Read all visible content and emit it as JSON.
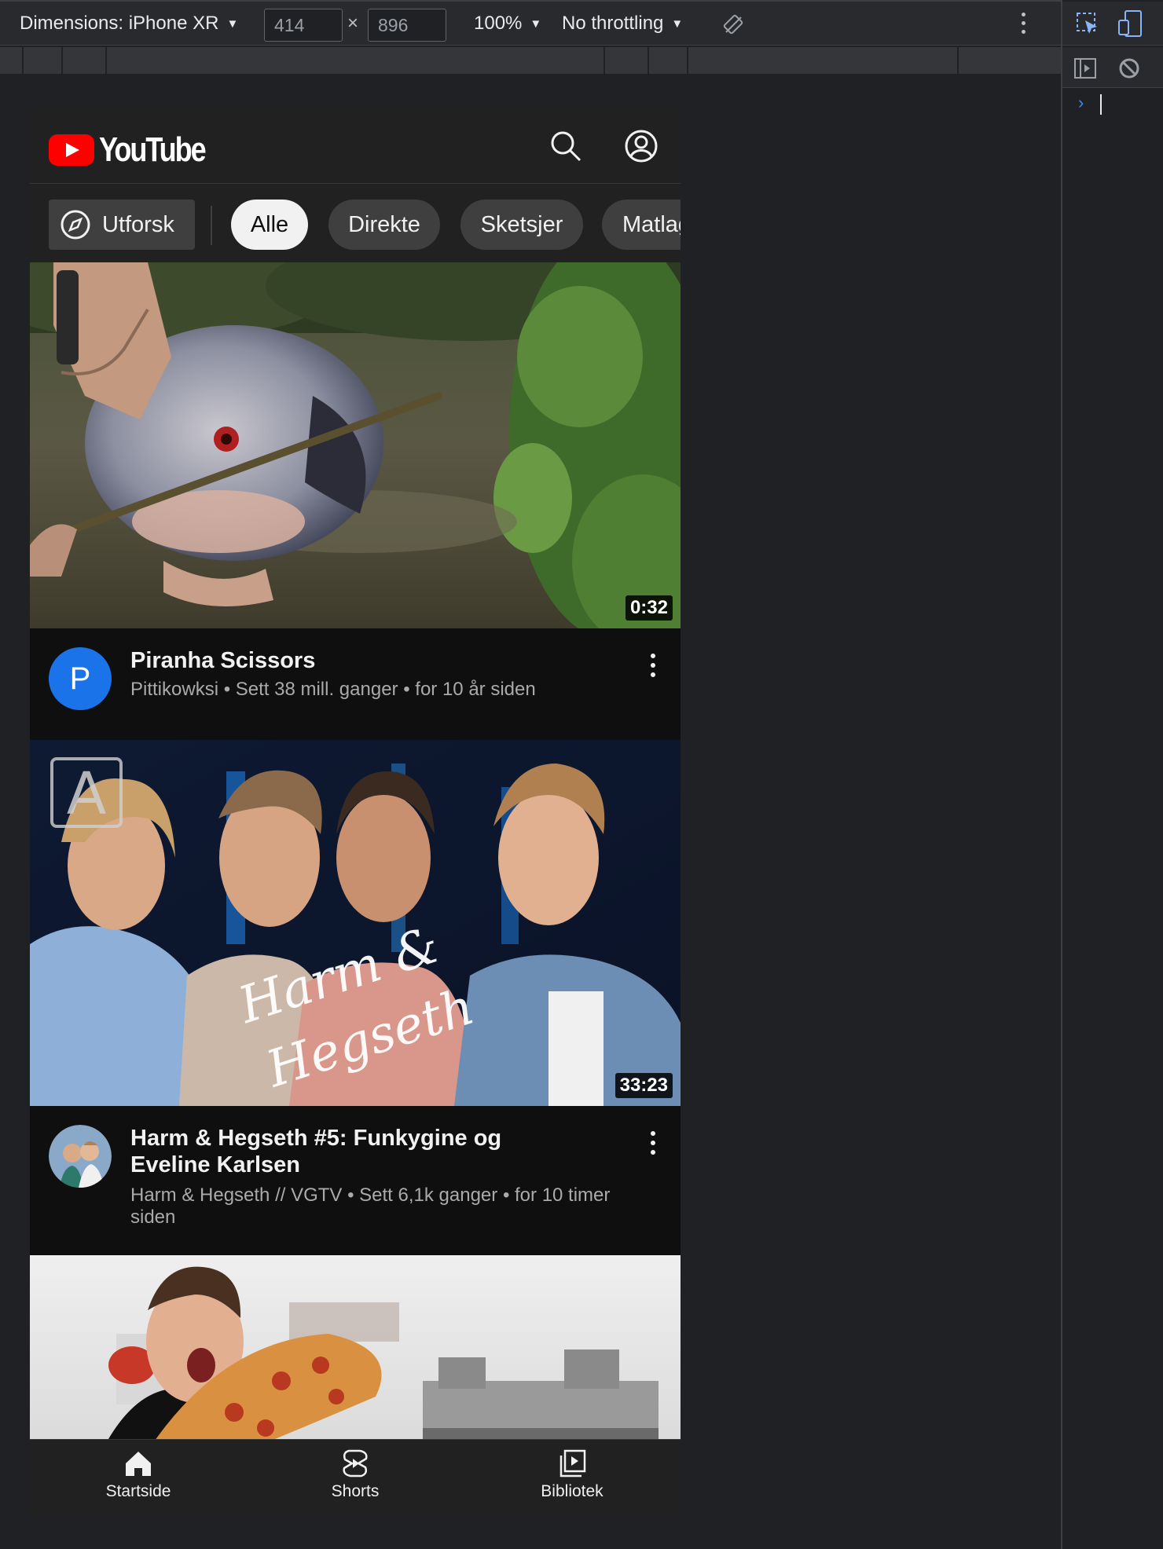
{
  "devtools": {
    "dimensions_label": "Dimensions: iPhone XR",
    "width": "414",
    "times": "×",
    "height": "896",
    "zoom": "100%",
    "throttling": "No throttling",
    "console_prompt": "›"
  },
  "youtube": {
    "logo_text": "YouTube",
    "chips": {
      "explore": "Utforsk",
      "items": [
        "Alle",
        "Direkte",
        "Sketsjer",
        "Matlaging"
      ]
    },
    "videos": [
      {
        "title": "Piranha Scissors",
        "subtitle": "Pittikowksi • Sett 38 mill. ganger • for 10 år siden",
        "duration": "0:32",
        "avatar_letter": "P"
      },
      {
        "title": "Harm & Hegseth #5: Funkygine og Eveline Karlsen",
        "subtitle": "Harm & Hegseth // VGTV • Sett 6,1k ganger • for 10 timer siden",
        "duration": "33:23",
        "thumb_letter": "A",
        "thumb_script": "Harm & Hegseth"
      }
    ],
    "nav": {
      "home": "Startside",
      "shorts": "Shorts",
      "library": "Bibliotek"
    }
  },
  "colors": {
    "brand_red": "#ff0000",
    "background": "#0f0f0f",
    "avatar_blue": "#1a73e8"
  }
}
